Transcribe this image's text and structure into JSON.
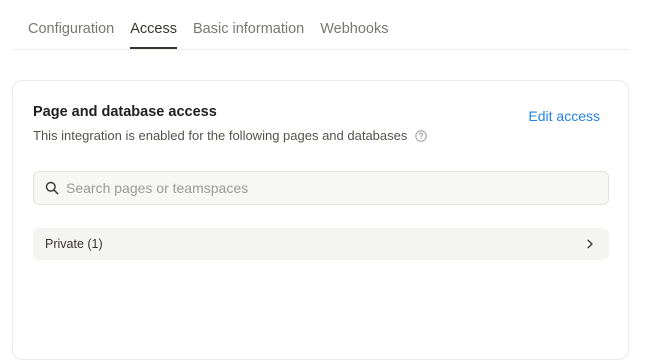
{
  "tabs": [
    {
      "label": "Configuration",
      "active": false
    },
    {
      "label": "Access",
      "active": true
    },
    {
      "label": "Basic information",
      "active": false
    },
    {
      "label": "Webhooks",
      "active": false
    }
  ],
  "access_card": {
    "title": "Page and database access",
    "description": "This integration is enabled for the following pages and databases",
    "help_icon": "question-circle-icon",
    "edit_label": "Edit access",
    "search": {
      "placeholder": "Search pages or teamspaces",
      "value": "",
      "icon": "search-icon"
    },
    "groups": [
      {
        "label": "Private (1)",
        "icon": "chevron-right-icon"
      }
    ]
  },
  "colors": {
    "accent": "#2383e2",
    "text": "#37352f",
    "muted": "#787774"
  }
}
